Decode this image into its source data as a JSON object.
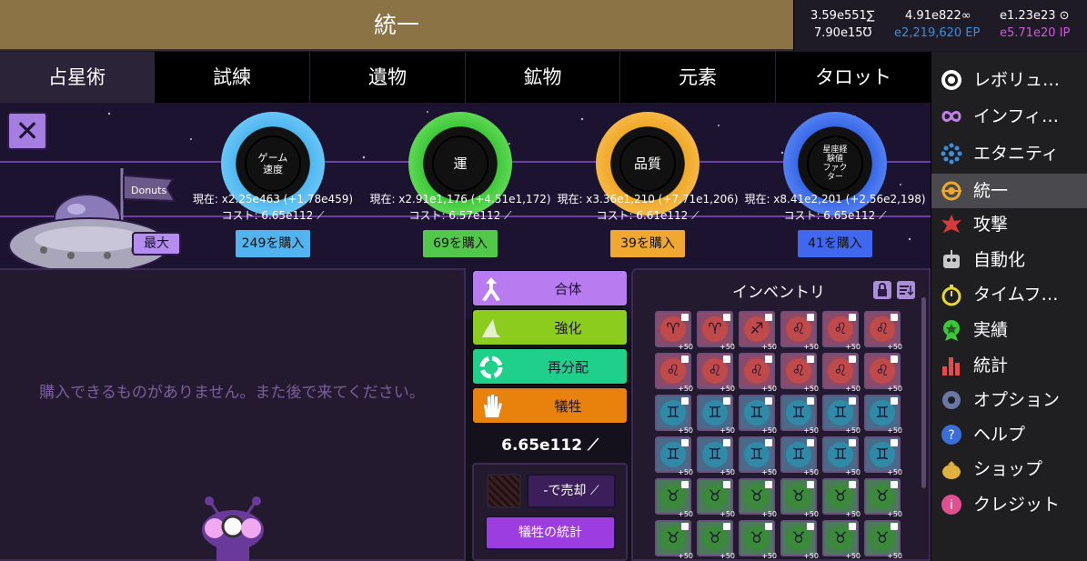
{
  "header": {
    "title": "統一"
  },
  "stats": {
    "s1": "3.59e551∑",
    "s2": "4.91e822∞",
    "s3": "e1.23e23 ⊙",
    "s4": "7.90e15Ʊ",
    "s5": "e2,219,620 EP",
    "s6": "e5.71e20 IP",
    "color_ep": "#3b8fe0",
    "color_ip": "#d05bd8"
  },
  "tabs": [
    {
      "label": "占星術"
    },
    {
      "label": "試練"
    },
    {
      "label": "遺物"
    },
    {
      "label": "鉱物"
    },
    {
      "label": "元素"
    },
    {
      "label": "タロット"
    }
  ],
  "ship": {
    "flag": "Donuts",
    "max_label": "最大"
  },
  "upgrades": [
    {
      "name": "ゲーム\n速度",
      "current": "現在: x2.25e463 (+1.78e459)",
      "cost": "コスト: 6.65e112 ⟋",
      "buy": "249を購入",
      "color": "#4fb8f0",
      "btn": "#52b4ee"
    },
    {
      "name": "運",
      "current": "現在: x2.91e1,176 (+4.51e1,172)",
      "cost": "コスト: 6.57e112 ⟋",
      "buy": "69を購入",
      "color": "#3ec83a",
      "btn": "#52c84a"
    },
    {
      "name": "品質",
      "current": "現在: x3.36e1,210 (+7.71e1,206)",
      "cost": "コスト: 6.61e112 ⟋",
      "buy": "39を購入",
      "color": "#f0a828",
      "btn": "#f0a830"
    },
    {
      "name": "星座経\n験値\nファク\nター",
      "current": "現在: x8.41e2,201 (+2.56e2,198)",
      "cost": "コスト: 6.65e112 ⟋",
      "buy": "41を購入",
      "color": "#3868e8",
      "btn": "#3f68ee"
    }
  ],
  "shop": {
    "empty_message": "購入できるものがありません。また後で来てください。"
  },
  "actions": [
    {
      "label": "合体",
      "color": "#b97cf0",
      "icon": "merge-icon"
    },
    {
      "label": "強化",
      "color": "#8ccc1c",
      "icon": "wizard-hat-icon"
    },
    {
      "label": "再分配",
      "color": "#1fd08a",
      "icon": "recycle-icon"
    },
    {
      "label": "犠牲",
      "color": "#e9820c",
      "icon": "hand-icon"
    }
  ],
  "total": "6.65e112 ⟋",
  "sell": {
    "sell_label": "-で売却 ⟋",
    "stats_label": "犠牲の統計"
  },
  "inventory": {
    "title": "インベントリ",
    "bonus": "+50",
    "rows": [
      [
        "♈",
        "♈",
        "♐",
        "♌",
        "♌",
        "♌"
      ],
      [
        "♌",
        "♌",
        "♌",
        "♌",
        "♌",
        "♌"
      ],
      [
        "♊",
        "♊",
        "♊",
        "♊",
        "♊",
        "♊"
      ],
      [
        "♊",
        "♊",
        "♊",
        "♊",
        "♊",
        "♊"
      ],
      [
        "♉",
        "♉",
        "♉",
        "♉",
        "♉",
        "♉"
      ],
      [
        "♉",
        "♉",
        "♉",
        "♉",
        "♉",
        "♉"
      ]
    ]
  },
  "sidebar": [
    {
      "label": "レボリュ…",
      "icon": "revolution-icon"
    },
    {
      "label": "インフィ…",
      "icon": "infinity-icon"
    },
    {
      "label": "エタニティ",
      "icon": "eternity-icon"
    },
    {
      "label": "統一",
      "icon": "unity-icon",
      "active": true
    },
    {
      "label": "攻撃",
      "icon": "attack-icon"
    },
    {
      "label": "自動化",
      "icon": "robot-icon"
    },
    {
      "label": "タイムフ…",
      "icon": "stopwatch-icon"
    },
    {
      "label": "実績",
      "icon": "medal-icon"
    },
    {
      "label": "統計",
      "icon": "bar-chart-icon"
    },
    {
      "label": "オプション",
      "icon": "gear-icon"
    },
    {
      "label": "ヘルプ",
      "icon": "help-icon"
    },
    {
      "label": "ショップ",
      "icon": "moneybag-icon"
    },
    {
      "label": "クレジット",
      "icon": "info-icon"
    }
  ]
}
